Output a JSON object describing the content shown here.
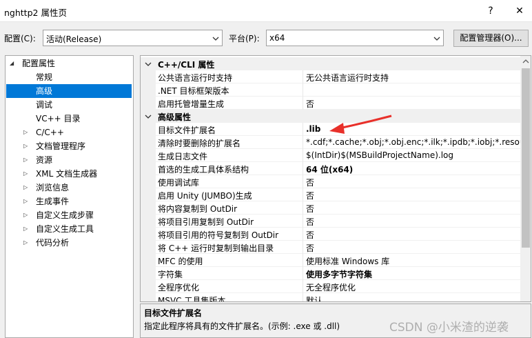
{
  "window": {
    "title": "nghttp2 属性页",
    "help": "?",
    "close": "✕"
  },
  "config": {
    "config_label": "配置(C):",
    "config_value": "活动(Release)",
    "platform_label": "平台(P):",
    "platform_value": "x64",
    "manager_button": "配置管理器(O)..."
  },
  "tree": {
    "root": "配置属性",
    "items": [
      {
        "label": "常规",
        "expandable": false
      },
      {
        "label": "高级",
        "expandable": false,
        "selected": true
      },
      {
        "label": "调试",
        "expandable": false
      },
      {
        "label": "VC++ 目录",
        "expandable": false
      },
      {
        "label": "C/C++",
        "expandable": true
      },
      {
        "label": "文档管理程序",
        "expandable": true
      },
      {
        "label": "资源",
        "expandable": true
      },
      {
        "label": "XML 文档生成器",
        "expandable": true
      },
      {
        "label": "浏览信息",
        "expandable": true
      },
      {
        "label": "生成事件",
        "expandable": true
      },
      {
        "label": "自定义生成步骤",
        "expandable": true
      },
      {
        "label": "自定义生成工具",
        "expandable": true
      },
      {
        "label": "代码分析",
        "expandable": true
      }
    ]
  },
  "grid": {
    "rows": [
      {
        "type": "category",
        "name": "C++/CLI 属性"
      },
      {
        "name": "公共语言运行时支持",
        "value": "无公共语言运行时支持"
      },
      {
        "name": ".NET 目标框架版本",
        "value": ""
      },
      {
        "name": "启用托管增量生成",
        "value": "否"
      },
      {
        "type": "category",
        "name": "高级属性"
      },
      {
        "name": "目标文件扩展名",
        "value": ".lib",
        "bold": true
      },
      {
        "name": "清除时要删除的扩展名",
        "value": "*.cdf;*.cache;*.obj;*.obj.enc;*.ilk;*.ipdb;*.iobj;*.resources"
      },
      {
        "name": "生成日志文件",
        "value": "$(IntDir)$(MSBuildProjectName).log"
      },
      {
        "name": "首选的生成工具体系结构",
        "value": "64 位(x64)",
        "bold": true
      },
      {
        "name": "使用调试库",
        "value": "否"
      },
      {
        "name": "启用 Unity (JUMBO)生成",
        "value": "否"
      },
      {
        "name": "将内容复制到 OutDir",
        "value": "否"
      },
      {
        "name": "将项目引用复制到 OutDir",
        "value": "否"
      },
      {
        "name": "将项目引用的符号复制到 OutDir",
        "value": "否"
      },
      {
        "name": "将 C++ 运行时复制到输出目录",
        "value": "否"
      },
      {
        "name": "MFC 的使用",
        "value": "使用标准 Windows 库"
      },
      {
        "name": "字符集",
        "value": "使用多字节字符集",
        "bold": true
      },
      {
        "name": "全程序优化",
        "value": "无全程序优化"
      },
      {
        "name": "MSVC 工具集版本",
        "value": "默认"
      }
    ]
  },
  "description": {
    "title": "目标文件扩展名",
    "text": "指定此程序将具有的文件扩展名。(示例: .exe 或 .dll)"
  },
  "watermark": "CSDN @小米渣的逆袭",
  "colors": {
    "selection": "#0078d7",
    "annotation_arrow": "#e8302a"
  }
}
